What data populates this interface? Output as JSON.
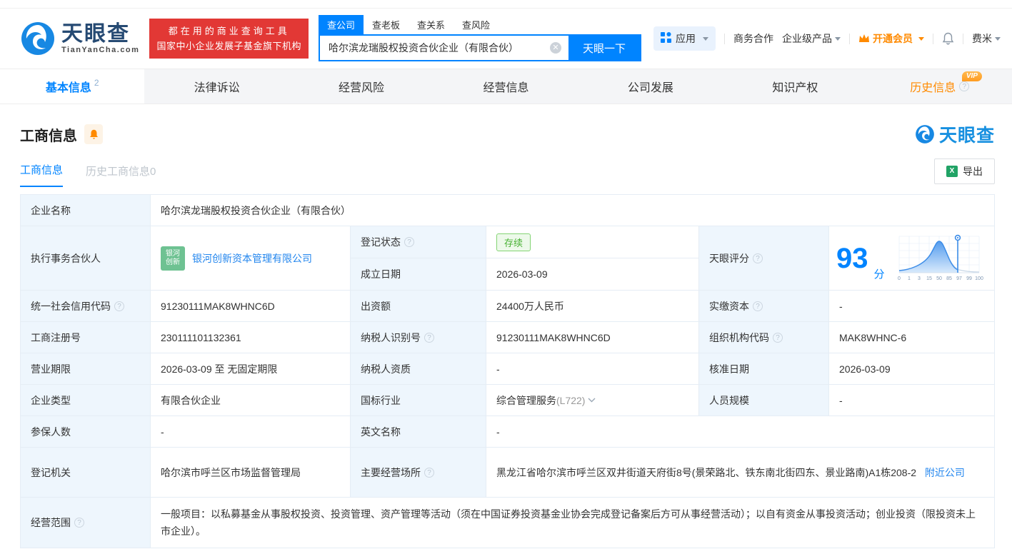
{
  "header": {
    "logo": {
      "brand": "天眼查",
      "domain": "TianYanCha.com"
    },
    "slogan": {
      "line1": "都在用的商业查询工具",
      "line2": "国家中小企业发展子基金旗下机构"
    },
    "search": {
      "tabs": [
        "查公司",
        "查老板",
        "查关系",
        "查风险"
      ],
      "value": "哈尔滨龙瑞股权投资合伙企业（有限合伙）",
      "button": "天眼一下"
    },
    "menu": {
      "apps": "应用",
      "cooperation": "商务合作",
      "enterprise": "企业级产品",
      "vip": "开通会员",
      "user": "费米"
    }
  },
  "nav_tabs": [
    {
      "label": "基本信息",
      "count": "2"
    },
    {
      "label": "法律诉讼"
    },
    {
      "label": "经营风险"
    },
    {
      "label": "经营信息"
    },
    {
      "label": "公司发展"
    },
    {
      "label": "知识产权"
    },
    {
      "label": "历史信息",
      "vip_badge": "VIP"
    }
  ],
  "section": {
    "title": "工商信息",
    "subtabs": [
      {
        "label": "工商信息"
      },
      {
        "label": "历史工商信息",
        "count": "0"
      }
    ],
    "watermark": "天眼查",
    "export_label": "导出"
  },
  "score": {
    "label": "天眼评分",
    "value": "93",
    "unit": "分",
    "ticks": [
      "0",
      "1",
      "3",
      "15",
      "50",
      "85",
      "97",
      "99",
      "100"
    ]
  },
  "table": {
    "company_name": {
      "label": "企业名称",
      "value": "哈尔滨龙瑞股权投资合伙企业（有限合伙）"
    },
    "partner": {
      "label": "执行事务合伙人",
      "badge_line1": "银河",
      "badge_line2": "创新",
      "value": "银河创新资本管理有限公司"
    },
    "reg_status": {
      "label": "登记状态",
      "value": "存续"
    },
    "establish_date": {
      "label": "成立日期",
      "value": "2026-03-09"
    },
    "credit_code": {
      "label": "统一社会信用代码",
      "value": "91230111MAK8WHNC6D"
    },
    "capital": {
      "label": "出资额",
      "value": "24400万人民币"
    },
    "paid_capital": {
      "label": "实缴资本",
      "value": "-"
    },
    "reg_number": {
      "label": "工商注册号",
      "value": "230111101132361"
    },
    "taxpayer_id": {
      "label": "纳税人识别号",
      "value": "91230111MAK8WHNC6D"
    },
    "org_code": {
      "label": "组织机构代码",
      "value": "MAK8WHNC-6"
    },
    "business_term": {
      "label": "营业期限",
      "value": "2026-03-09 至 无固定期限"
    },
    "taxpayer_quality": {
      "label": "纳税人资质",
      "value": "-"
    },
    "approval_date": {
      "label": "核准日期",
      "value": "2026-03-09"
    },
    "company_type": {
      "label": "企业类型",
      "value": "有限合伙企业"
    },
    "industry": {
      "label": "国标行业",
      "value": "综合管理服务",
      "code": "(L722)"
    },
    "staff_size": {
      "label": "人员规模",
      "value": "-"
    },
    "insured_count": {
      "label": "参保人数",
      "value": "-"
    },
    "english_name": {
      "label": "英文名称",
      "value": "-"
    },
    "reg_authority": {
      "label": "登记机关",
      "value": "哈尔滨市呼兰区市场监督管理局"
    },
    "business_address": {
      "label": "主要经营场所",
      "value": "黑龙江省哈尔滨市呼兰区双井街道天府街8号(景荣路北、铁东南北街四东、景业路南)A1栋208-2",
      "link": "附近公司"
    },
    "business_scope": {
      "label": "经营范围",
      "value": "一般项目：以私募基金从事股权投资、投资管理、资产管理等活动（须在中国证券投资基金业协会完成登记备案后方可从事经营活动）；以自有资金从事投资活动；创业投资（限投资未上市企业）。"
    }
  },
  "colors": {
    "brand_blue": "#0084ff",
    "banner_red": "#e23835",
    "vip_orange": "#ff8a00",
    "status_green": "#48b133",
    "label_cell_bg": "#eef6fd"
  }
}
